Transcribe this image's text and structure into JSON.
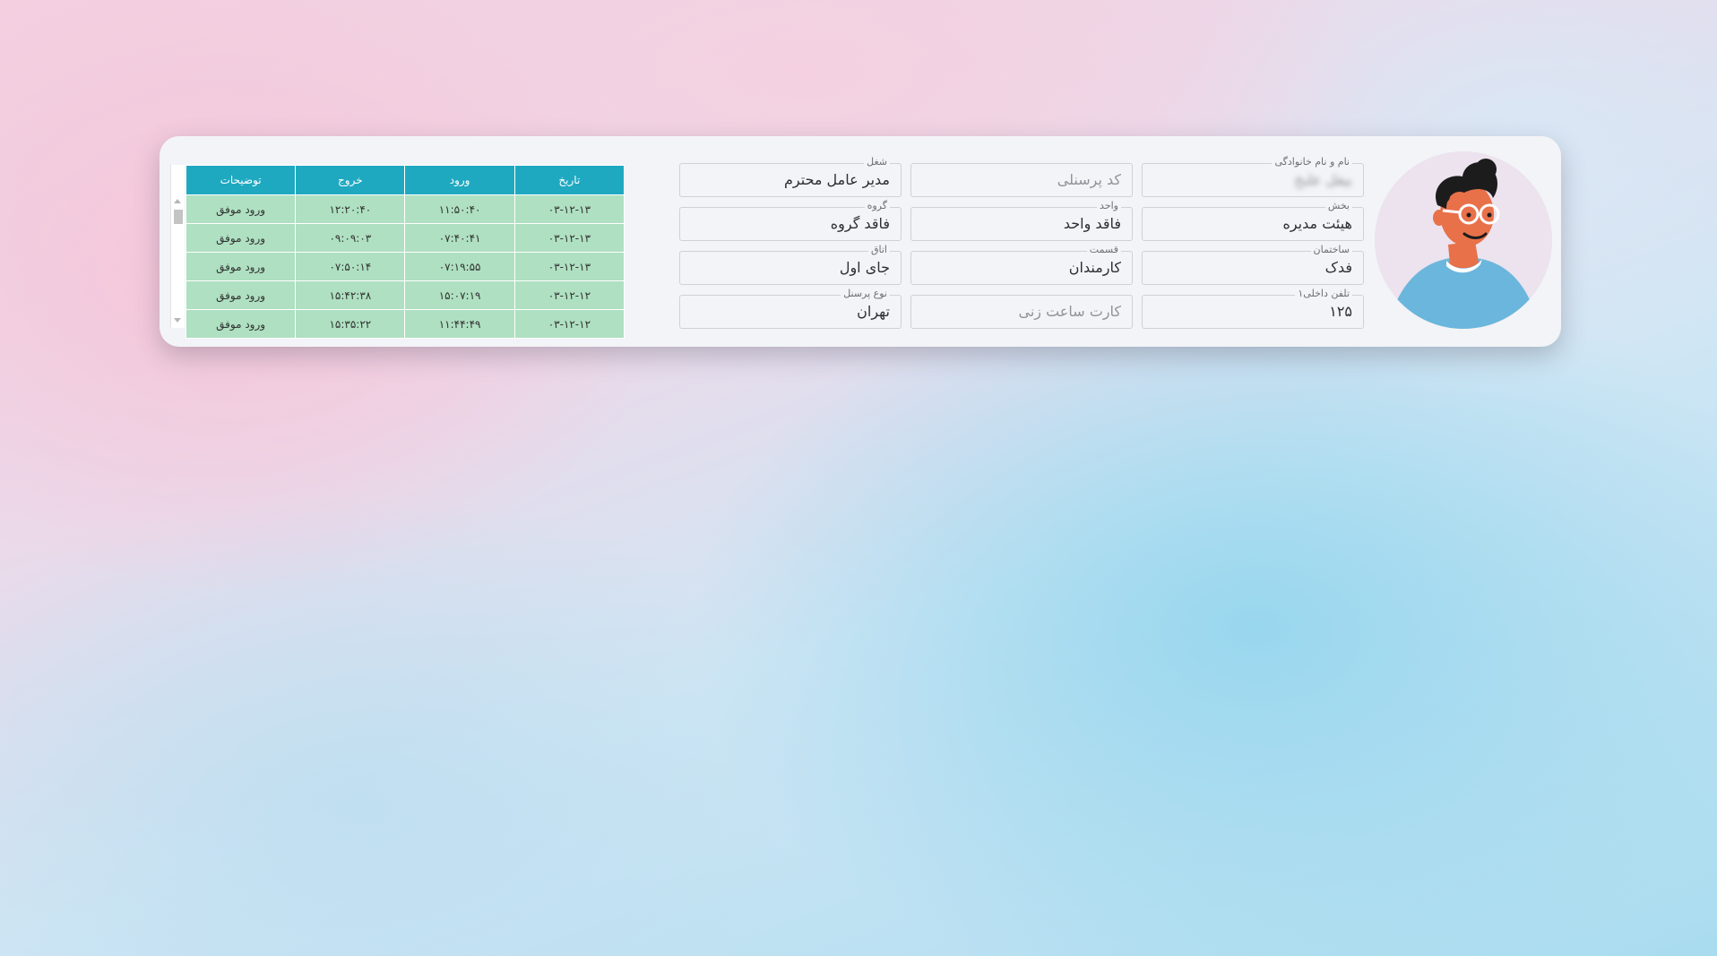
{
  "profile": {
    "fields": {
      "full_name": {
        "label": "نام و نام خانوادگی",
        "value": "بيقل علىخ"
      },
      "section": {
        "label": "بخش",
        "value": "هیئت مدیره"
      },
      "building": {
        "label": "ساختمان",
        "value": "فدک"
      },
      "phone": {
        "label": "تلفن داخلی۱",
        "value": "۱۲۵"
      },
      "personnel_code": {
        "label": "",
        "value": "کد پرسنلی"
      },
      "unit": {
        "label": "واحد",
        "value": "فاقد واحد"
      },
      "division": {
        "label": "قسمت",
        "value": "کارمندان"
      },
      "card": {
        "label": "",
        "value": "کارت ساعت زنی"
      },
      "job": {
        "label": "شغل",
        "value": "مدیر عامل محترم"
      },
      "group": {
        "label": "گروه",
        "value": "فاقد گروه"
      },
      "room": {
        "label": "اتاق",
        "value": "جای اول"
      },
      "personnel_type": {
        "label": "نوع پرسنل",
        "value": "تهران"
      }
    }
  },
  "attendance": {
    "headers": {
      "date": "تاریخ",
      "entry": "ورود",
      "exit": "خروج",
      "notes": "توضیحات"
    },
    "rows": [
      {
        "date": "۰۳-۱۲-۱۳",
        "entry": "۱۱:۵۰:۴۰",
        "exit": "۱۲:۲۰:۴۰",
        "notes": "ورود موفق"
      },
      {
        "date": "۰۳-۱۲-۱۳",
        "entry": "۰۷:۴۰:۴۱",
        "exit": "۰۹:۰۹:۰۳",
        "notes": "ورود موفق"
      },
      {
        "date": "۰۳-۱۲-۱۳",
        "entry": "۰۷:۱۹:۵۵",
        "exit": "۰۷:۵۰:۱۴",
        "notes": "ورود موفق"
      },
      {
        "date": "۰۳-۱۲-۱۲",
        "entry": "۱۵:۰۷:۱۹",
        "exit": "۱۵:۴۲:۳۸",
        "notes": "ورود موفق"
      },
      {
        "date": "۰۳-۱۲-۱۲",
        "entry": "۱۱:۴۴:۴۹",
        "exit": "۱۵:۳۵:۲۲",
        "notes": "ورود موفق"
      }
    ]
  },
  "colors": {
    "header": "#1fa9c1",
    "row": "#aee0c1",
    "avatar_shirt": "#6bb6dc",
    "avatar_skin": "#e8714a"
  }
}
